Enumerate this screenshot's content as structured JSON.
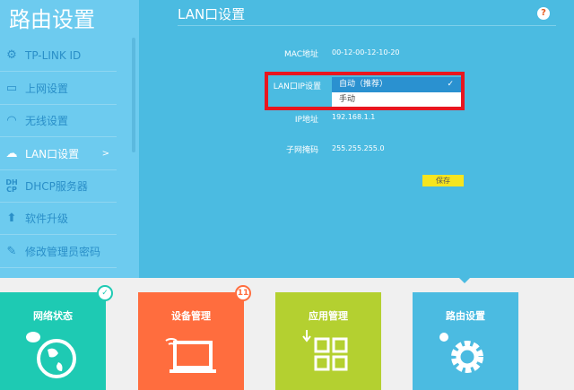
{
  "sidebar": {
    "title": "路由设置",
    "items": [
      {
        "icon": "gear-icon",
        "label": "TP-LINK ID"
      },
      {
        "icon": "laptop-icon",
        "label": "上网设置"
      },
      {
        "icon": "wifi-icon",
        "label": "无线设置"
      },
      {
        "icon": "lan-icon",
        "label": "LAN口设置",
        "active": true,
        "arrow": ">"
      },
      {
        "icon": "dhcp-icon",
        "label": "DHCP服务器",
        "icon_text": "DH CP"
      },
      {
        "icon": "upload-icon",
        "label": "软件升级"
      },
      {
        "icon": "pencil-icon",
        "label": "修改管理员密码"
      }
    ]
  },
  "main": {
    "title": "LAN口设置",
    "help": "?",
    "fields": {
      "mac_label": "MAC地址",
      "mac_value": "00-12-00-12-10-20",
      "lanip_label": "LAN口IP设置",
      "lanip_selected": "自动（推荐）",
      "lanip_option": "手动",
      "ip_label": "IP地址",
      "ip_value": "192.168.1.1",
      "mask_label": "子网掩码",
      "mask_value": "255.255.255.0"
    },
    "save": "保存"
  },
  "tiles": [
    {
      "label": "网络状态",
      "color": "#1ecab3",
      "badge": "✓"
    },
    {
      "label": "设备管理",
      "color": "#ff6d3e",
      "badge": "11"
    },
    {
      "label": "应用管理",
      "color": "#b4d030"
    },
    {
      "label": "路由设置",
      "color": "#4bbbe1"
    }
  ]
}
